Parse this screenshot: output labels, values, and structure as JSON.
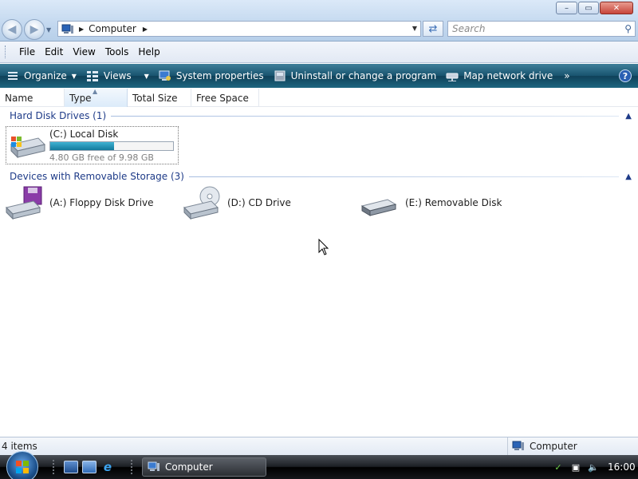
{
  "window": {
    "title_controls": {
      "minimize": "–",
      "maximize": "▭",
      "close": "✕"
    }
  },
  "address": {
    "crumb": "Computer",
    "search_placeholder": "Search"
  },
  "menu": [
    "File",
    "Edit",
    "View",
    "Tools",
    "Help"
  ],
  "commands": {
    "organize": "Organize",
    "views": "Views",
    "system_properties": "System properties",
    "uninstall": "Uninstall or change a program",
    "map_drive": "Map network drive",
    "more": "»",
    "help": "?"
  },
  "columns": [
    "Name",
    "Type",
    "Total Size",
    "Free Space"
  ],
  "groups": {
    "hard_disk": {
      "title": "Hard Disk Drives (1)"
    },
    "removable": {
      "title": "Devices with Removable Storage (3)"
    }
  },
  "drives": {
    "c": {
      "name": "(C:) Local Disk",
      "free_text": "4.80 GB free of 9.98 GB",
      "used_fraction": 0.519
    },
    "a": {
      "name": "(A:) Floppy Disk Drive"
    },
    "d": {
      "name": "(D:) CD Drive"
    },
    "e": {
      "name": "(E:) Removable Disk"
    }
  },
  "status": {
    "items": "4 items",
    "location": "Computer"
  },
  "taskbar": {
    "window_button": "Computer",
    "clock": "16:00"
  },
  "colors": {
    "command_bar": "#18546f",
    "group_header": "#1e3b88",
    "drive_bar_fill": "#137a9c"
  },
  "icons": {
    "back": "back-arrow-icon",
    "forward": "forward-arrow-icon",
    "refresh": "refresh-icon",
    "search": "search-icon"
  }
}
